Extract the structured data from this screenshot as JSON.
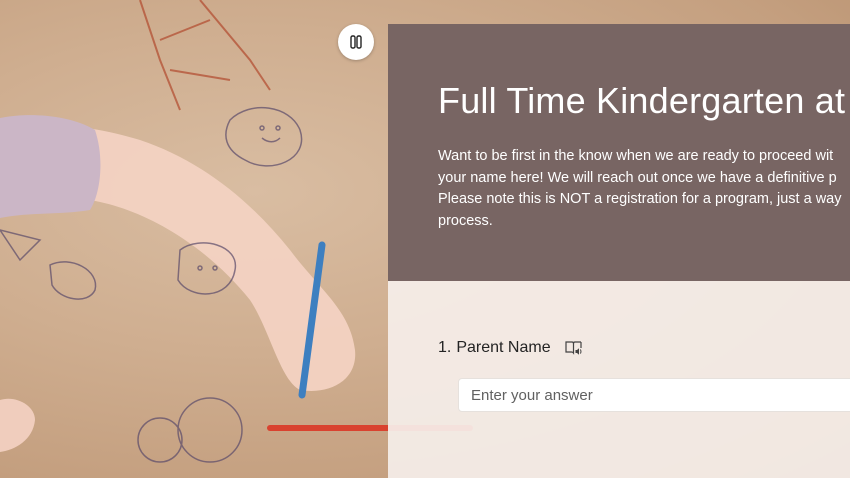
{
  "form": {
    "title": "Full Time Kindergarten at",
    "description": "Want to be first in the know when we are ready to proceed wit\nyour name here!  We will reach out once we have a definitive p\nPlease note this is NOT a registration for a program, just a way\nprocess.",
    "header_color": "#786563",
    "questions": [
      {
        "number": "1.",
        "label": "Parent Name",
        "placeholder": "Enter your answer"
      }
    ]
  },
  "icons": {
    "pause": "pause-icon",
    "reader": "immersive-reader-icon"
  }
}
